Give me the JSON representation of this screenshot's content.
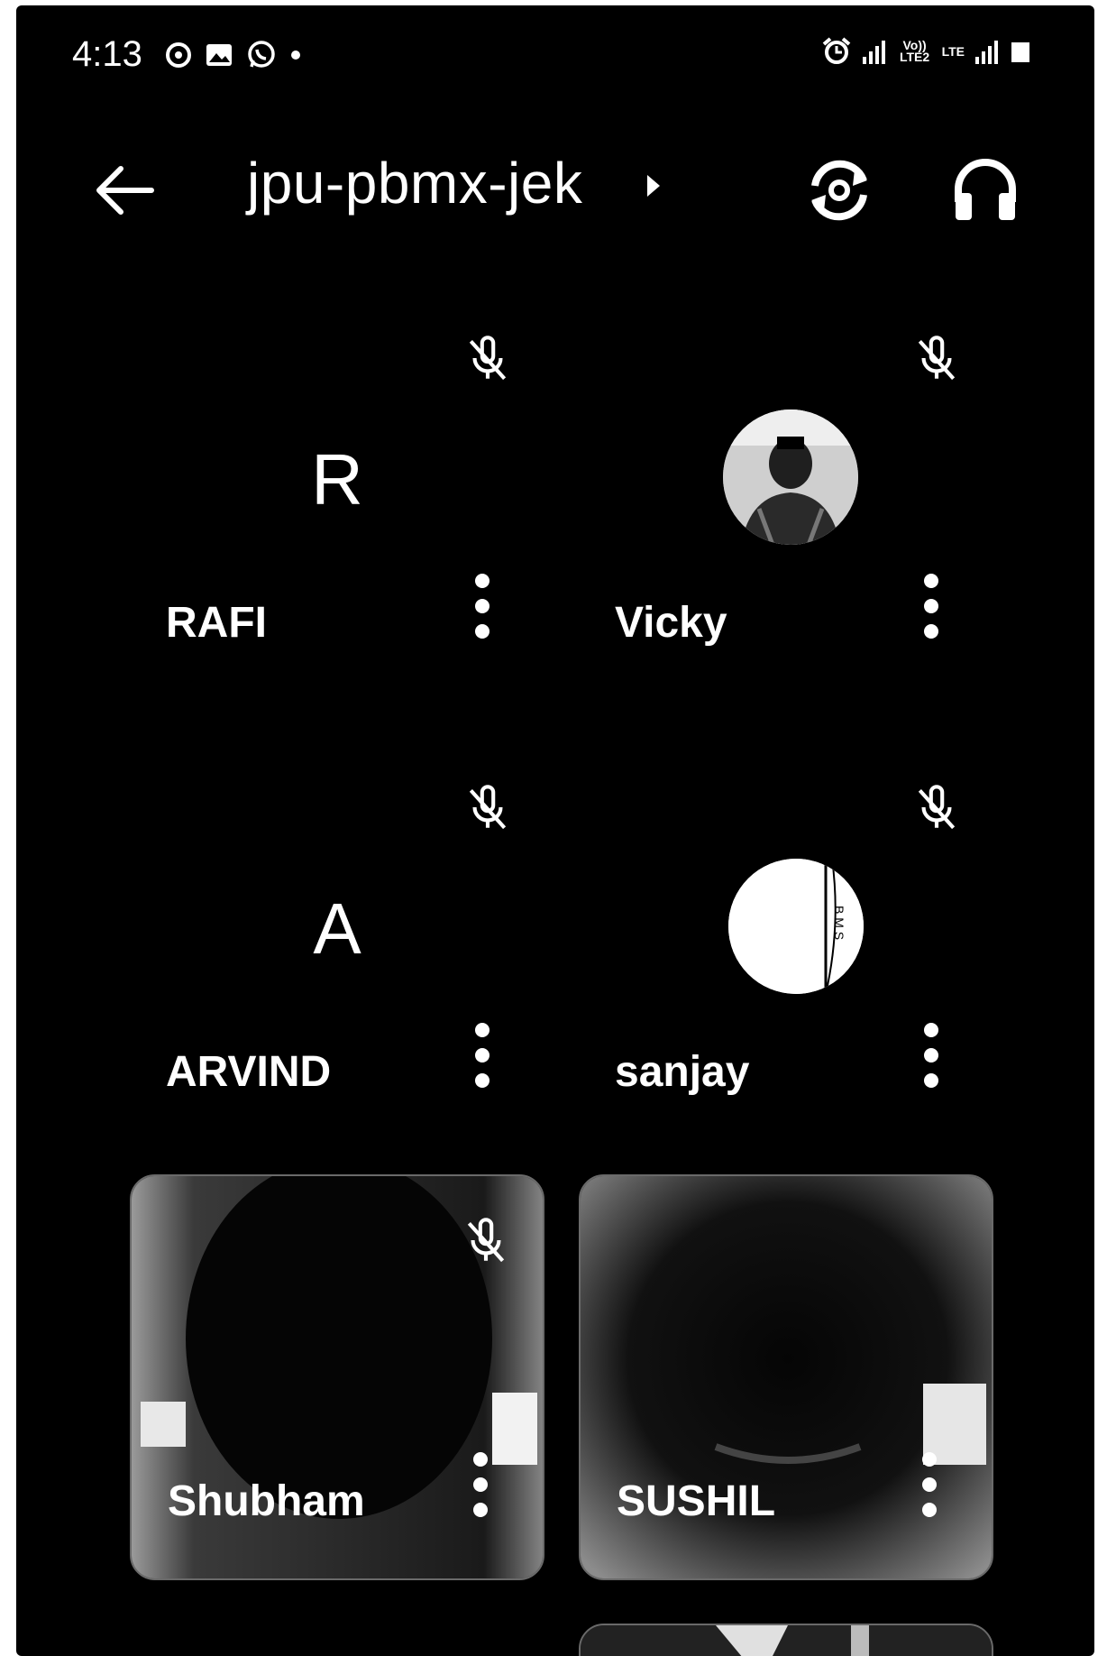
{
  "status_bar": {
    "time": "4:13",
    "left_icons": [
      "threads-icon",
      "gallery-icon",
      "whatsapp-icon",
      "dot-icon"
    ],
    "right_icons": [
      "alarm-icon",
      "signal-1-icon",
      "volte-icon",
      "lte-icon",
      "signal-2-icon",
      "battery-icon"
    ],
    "volte_label": "Vo)) LTE2",
    "lte_label": "LTE"
  },
  "app_bar": {
    "meeting_code": "jpu-pbmx-jek"
  },
  "participants": [
    {
      "name": "RAFI",
      "initial": "R",
      "muted": true,
      "type": "initial"
    },
    {
      "name": "Vicky",
      "initial": "",
      "muted": true,
      "type": "photo"
    },
    {
      "name": "ARVIND",
      "initial": "A",
      "muted": true,
      "type": "initial"
    },
    {
      "name": "sanjay",
      "initial": "",
      "muted": true,
      "type": "logo",
      "logo_text": "B M S"
    },
    {
      "name": "Shubham",
      "initial": "",
      "muted": true,
      "type": "video"
    },
    {
      "name": "SUSHIL",
      "initial": "",
      "muted": false,
      "type": "video"
    }
  ]
}
